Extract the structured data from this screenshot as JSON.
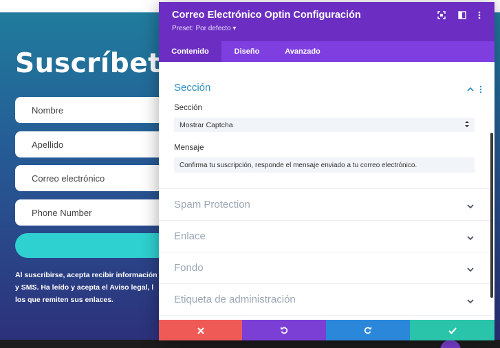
{
  "page": {
    "hero_title": "Suscríbete",
    "fields": [
      {
        "placeholder": "Nombre"
      },
      {
        "placeholder": "Apellido"
      },
      {
        "placeholder": "Correo electrónico"
      },
      {
        "placeholder": "Phone Number"
      }
    ],
    "consent_lines": [
      "Al suscribirse, acepta recibir información",
      "y SMS. Ha leído y acepta el Aviso legal, l",
      "los que remiten sus enlaces."
    ],
    "colors": {
      "submit": "#2fd0d0"
    }
  },
  "modal": {
    "title": "Correo Electrónico Optin Configuración",
    "preset": "Preset: Por defecto ▾",
    "header_icons": [
      "fullscreen-icon",
      "columns-icon",
      "more-vert-icon"
    ],
    "tabs": [
      {
        "label": "Contenido",
        "active": true
      },
      {
        "label": "Diseño",
        "active": false
      },
      {
        "label": "Avanzado",
        "active": false
      }
    ],
    "section": {
      "title": "Sección",
      "select_label": "Sección",
      "select_value": "Mostrar Captcha",
      "message_label": "Mensaje",
      "message_value": "Confirma tu suscripción, responde el mensaje enviado a tu correo electrónico."
    },
    "collapsed_sections": [
      {
        "label": "Spam Protection"
      },
      {
        "label": "Enlace"
      },
      {
        "label": "Fondo"
      },
      {
        "label": "Etiqueta de administración"
      }
    ],
    "footer_buttons": [
      {
        "name": "cancel",
        "icon": "close-icon",
        "color": "#ef5a56"
      },
      {
        "name": "undo",
        "icon": "undo-icon",
        "color": "#7b3fd6"
      },
      {
        "name": "redo",
        "icon": "redo-icon",
        "color": "#2b87da"
      },
      {
        "name": "save",
        "icon": "check-icon",
        "color": "#29c4a9"
      }
    ]
  }
}
